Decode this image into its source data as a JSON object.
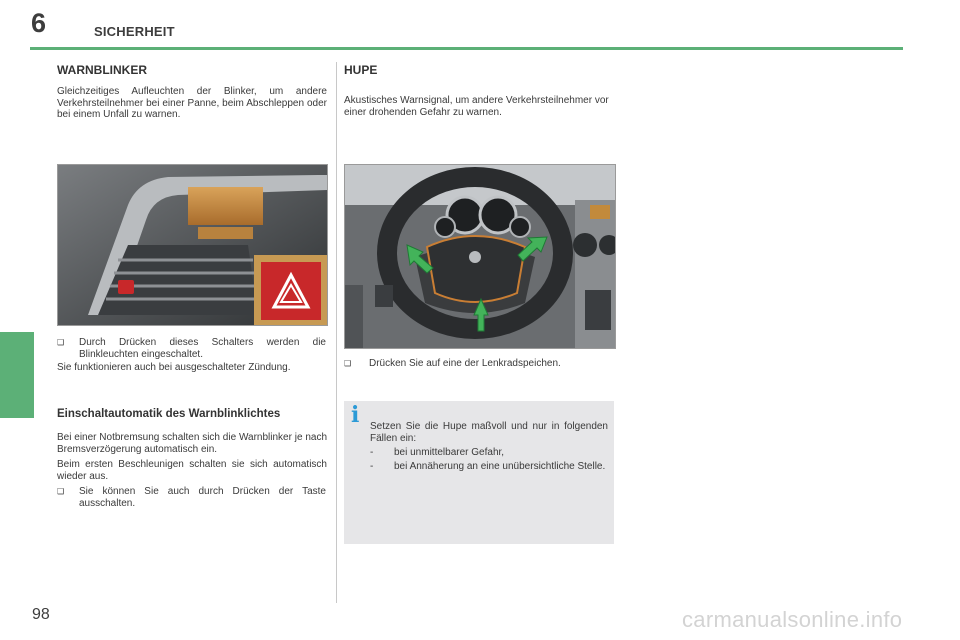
{
  "header": {
    "chapter_number": "6",
    "chapter_title": "SICHERHEIT"
  },
  "footer": {
    "page_number": "98",
    "watermark": "carmanualsonline.info"
  },
  "left": {
    "title": "WARNBLINKER",
    "intro": "Gleichzeitiges Aufleuchten der Blinker, um andere Verkehrsteilnehmer bei einer Panne, beim Abschleppen oder bei einem Unfall zu warnen.",
    "bullet1": "Durch Drücken dieses Schalters werden die Blinkleuchten eingeschaltet.",
    "note": "Sie funktionieren auch bei ausgeschalteter Zündung.",
    "subtitle": "Einschaltautomatik des Warnblinklichtes",
    "para1": "Bei einer Notbremsung schalten sich die Warnblinker je nach Bremsverzögerung automatisch ein.",
    "para2": "Beim ersten Beschleunigen schalten sie sich automatisch wieder aus.",
    "bullet2": "Sie können Sie auch durch Drücken der Taste ausschalten."
  },
  "right": {
    "title": "HUPE",
    "intro": "Akustisches Warnsignal, um andere Verkehrsteilnehmer vor einer drohenden Gefahr zu warnen.",
    "bullet": "Drücken Sie auf eine der Lenkradspeichen.",
    "info": {
      "icon": "i",
      "text": "Setzen Sie die Hupe maßvoll und nur in folgenden Fällen ein:",
      "items": [
        {
          "dash": "-",
          "text": "bei unmittelbarer Gefahr,"
        },
        {
          "dash": "-",
          "text": "bei Annäherung an eine unübersichtliche Stelle."
        }
      ]
    }
  },
  "bullet_marker": "❑",
  "colors": {
    "accent_green": "#5cb077",
    "info_blue": "#2c9ad6",
    "info_bg": "#e6e6e8",
    "hazard_red": "#c8282a"
  }
}
